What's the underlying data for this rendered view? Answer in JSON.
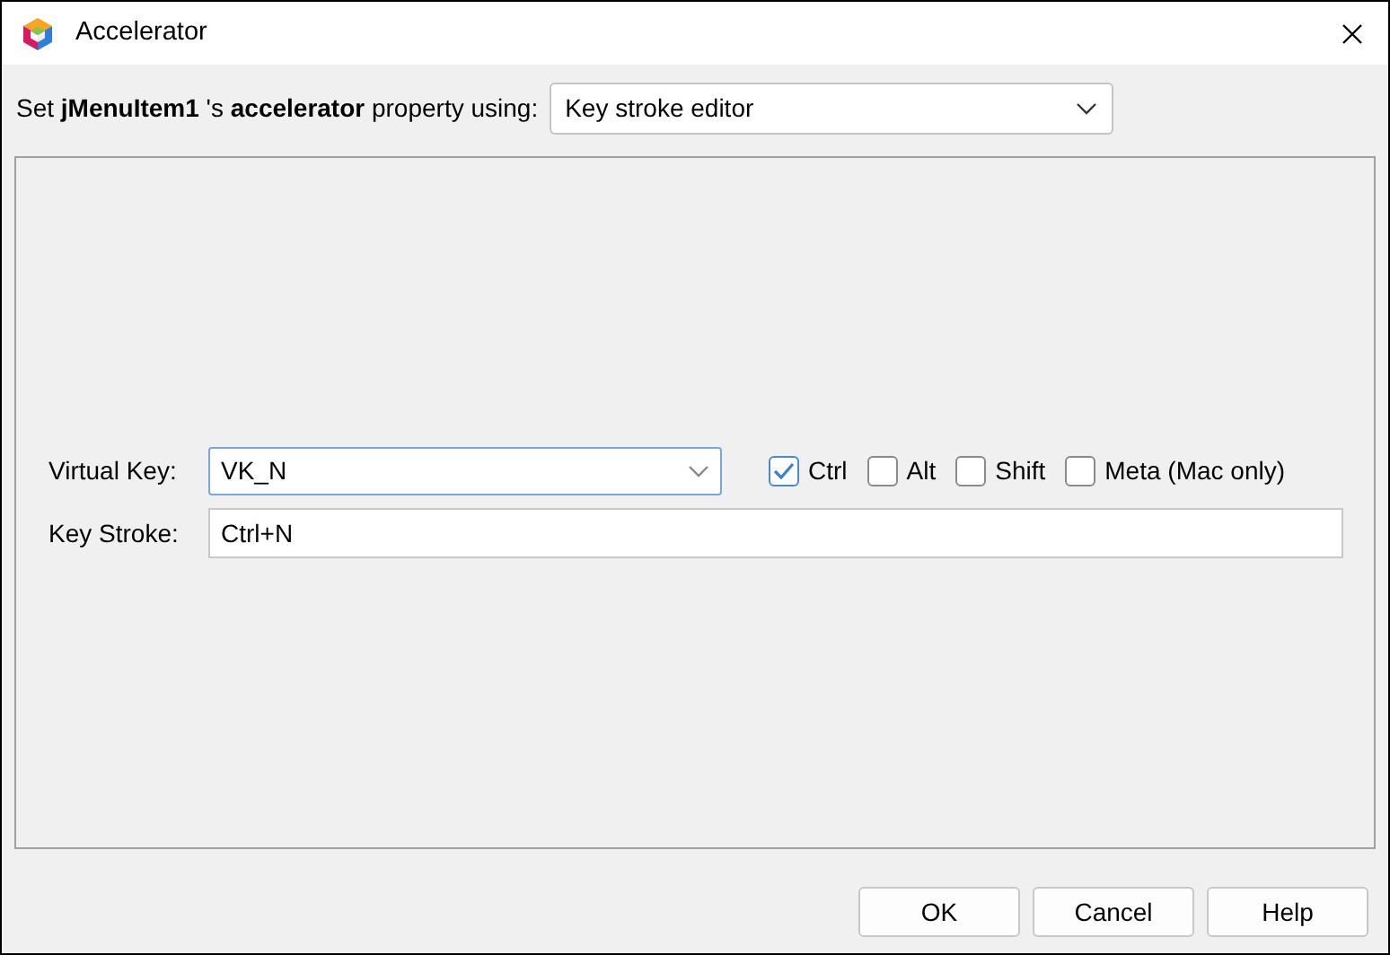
{
  "window": {
    "title": "Accelerator"
  },
  "property_line": {
    "text": "Set **jMenuItem1** 's **accelerator** property using:",
    "editor": "Key stroke editor"
  },
  "virtual_key": {
    "label": "Virtual Key:",
    "value": "VK_N"
  },
  "modifiers": [
    {
      "label": "Ctrl",
      "checked": true
    },
    {
      "label": "Alt",
      "checked": false
    },
    {
      "label": "Shift",
      "checked": false
    },
    {
      "label": "Meta (Mac only)",
      "checked": false
    }
  ],
  "key_stroke": {
    "label": "Key Stroke:",
    "value": "Ctrl+N"
  },
  "buttons": [
    "OK",
    "Cancel",
    "Help"
  ]
}
